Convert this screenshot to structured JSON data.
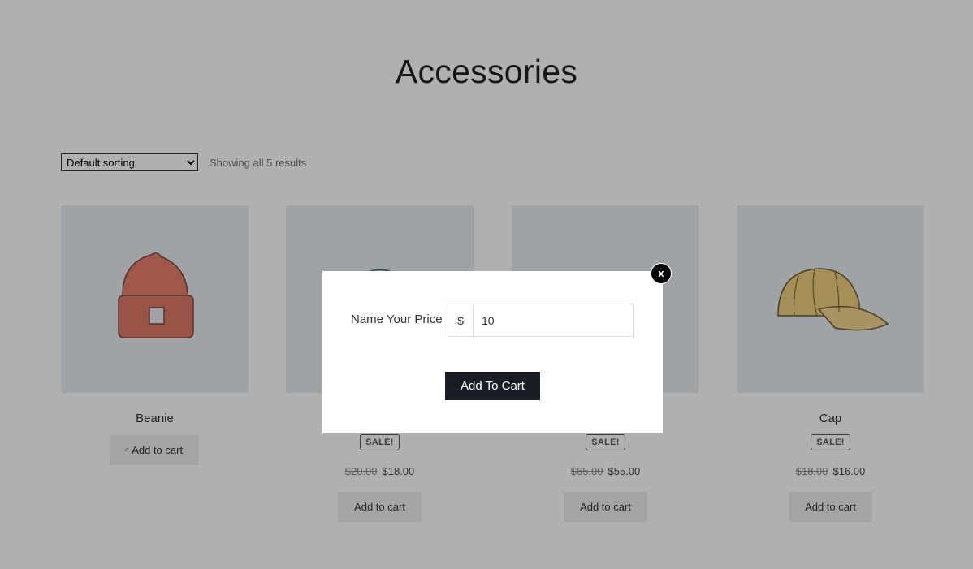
{
  "page": {
    "title": "Accessories"
  },
  "toolbar": {
    "sorting_selected": "Default sorting",
    "results_text": "Showing all 5 results"
  },
  "products": [
    {
      "name": "Beanie",
      "button": "Add to cart",
      "loading": true
    },
    {
      "name": "",
      "sale": "SALE!",
      "old_price": "$20.00",
      "price": "$18.00",
      "button": "Add to cart"
    },
    {
      "name": "",
      "sale": "SALE!",
      "old_price": "$65.00",
      "price": "$55.00",
      "button": "Add to cart"
    },
    {
      "name": "Cap",
      "sale": "SALE!",
      "old_price": "$18.00",
      "price": "$16.00",
      "button": "Add to cart"
    }
  ],
  "modal": {
    "close_label": "x",
    "price_label": "Name Your Price",
    "currency": "$",
    "price_value": "10",
    "add_button": "Add To Cart"
  },
  "colors": {
    "overlay": "rgba(0,0,0,0.31)",
    "modal_button": "#1c1c24",
    "product_bg": "#e7edef"
  }
}
